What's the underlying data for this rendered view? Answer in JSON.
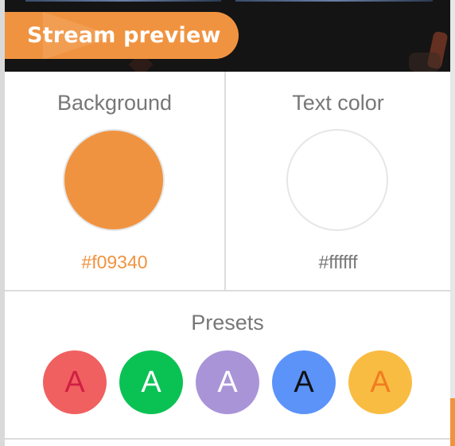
{
  "preview": {
    "title": "Stream preview",
    "badge_color": "#f09340"
  },
  "background": {
    "label": "Background",
    "value": "#f09340",
    "value_text_color": "#f09340"
  },
  "text_color": {
    "label": "Text color",
    "value": "#ffffff",
    "value_text_color": "#777777"
  },
  "presets": {
    "label": "Presets",
    "items": [
      {
        "letter": "A",
        "background": "#f06060",
        "color": "#d02043"
      },
      {
        "letter": "A",
        "background": "#0ac254",
        "color": "#ffffff"
      },
      {
        "letter": "A",
        "background": "#a994d8",
        "color": "#ffffff"
      },
      {
        "letter": "A",
        "background": "#5b93f9",
        "color": "#111111"
      },
      {
        "letter": "A",
        "background": "#f9bc42",
        "color": "#f07c20"
      }
    ]
  }
}
